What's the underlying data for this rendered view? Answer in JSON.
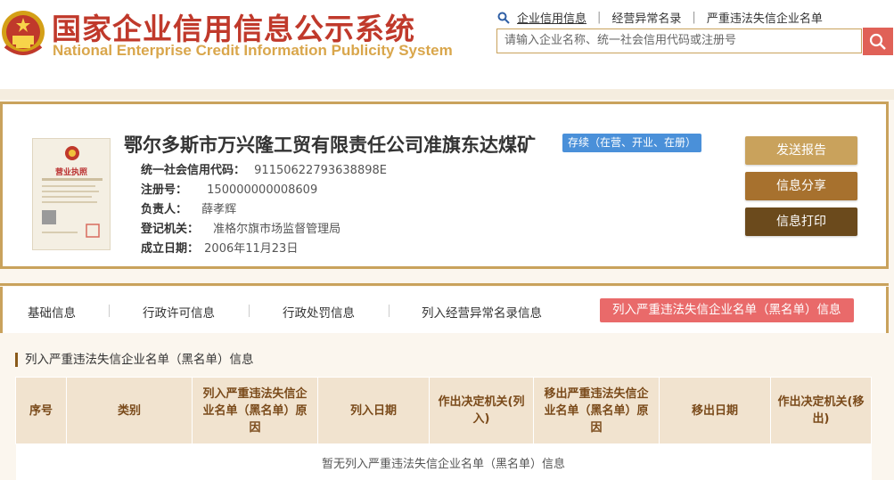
{
  "header": {
    "title_cn": "国家企业信用信息公示系统",
    "title_en": "National Enterprise Credit Information Publicity System",
    "links": [
      "企业信用信息",
      "经营异常名录",
      "严重违法失信企业名单"
    ],
    "search_placeholder": "请输入企业名称、统一社会信用代码或注册号"
  },
  "company": {
    "name": "鄂尔多斯市万兴隆工贸有限责任公司准旗东达煤矿",
    "status": "存续（在营、开业、在册）",
    "license_label": "营业执照",
    "fields": [
      {
        "label": "统一社会信用代码：",
        "value": "91150622793638898E"
      },
      {
        "label": "注册号：",
        "value": "150000000008609"
      },
      {
        "label": "负责人：",
        "value": "薛孝辉"
      },
      {
        "label": "登记机关：",
        "value": "准格尔旗市场监督管理局"
      },
      {
        "label": "成立日期：",
        "value": "2006年11月23日"
      }
    ],
    "actions": [
      {
        "label": "发送报告",
        "color": "#c9a25c"
      },
      {
        "label": "信息分享",
        "color": "#a7712e"
      },
      {
        "label": "信息打印",
        "color": "#6b4a1c"
      }
    ]
  },
  "tabs": [
    "基础信息",
    "行政许可信息",
    "行政处罚信息",
    "列入经营异常名录信息",
    "列入严重违法失信企业名单（黑名单）信息"
  ],
  "section": {
    "title": "列入严重违法失信企业名单（黑名单）信息",
    "columns": [
      "序号",
      "类别",
      "列入严重违法失信企业名单（黑名单）原因",
      "列入日期",
      "作出决定机关(列入)",
      "移出严重违法失信企业名单（黑名单）原因",
      "移出日期",
      "作出决定机关(移出)"
    ],
    "empty_text": "暂无列入严重违法失信企业名单（黑名单）信息"
  },
  "colors": {
    "brand_red": "#c0392b",
    "gold": "#c9a25c",
    "status_blue": "#4a90d9",
    "active_tab": "#e96a6a"
  }
}
